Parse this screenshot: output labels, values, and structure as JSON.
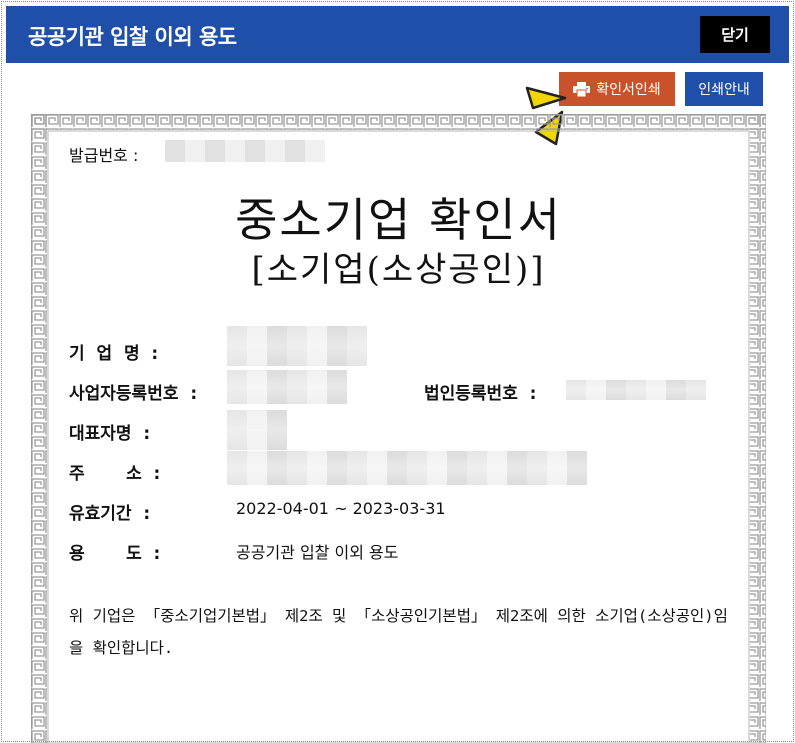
{
  "header": {
    "title": "공공기관 입찰 이외 용도",
    "close_label": "닫기"
  },
  "toolbar": {
    "print_label": "확인서인쇄",
    "guide_label": "인쇄안내"
  },
  "certificate": {
    "issue_label": "발급번호 :",
    "title": "중소기업 확인서",
    "subtitle": "[소기업(소상공인)]",
    "fields": {
      "company_label": "기  업  명  :",
      "business_reg_label": "사업자등록번호  :",
      "corp_reg_label": "법인등록번호  :",
      "ceo_label": "대표자명  :",
      "address_label": "주       소  :",
      "validity_label": "유효기간  :",
      "validity_value": "2022-04-01 ~ 2023-03-31",
      "purpose_label": "용       도  :",
      "purpose_value": "공공기관 입찰 이외 용도"
    },
    "statement": " 위 기업은 「중소기업기본법」 제2조 및 「소상공인기본법」 제2조에 의한 소기업(소상공인)임을 확인합니다."
  },
  "colors": {
    "header_bg": "#1f4fa8",
    "print_button_bg": "#c8522a",
    "guide_button_bg": "#1f4fa8",
    "close_button_bg": "#000000",
    "pointer_yellow": "#f2d600"
  },
  "icons": {
    "print": "printer-icon",
    "pointer": "yellow-pointer-icon"
  }
}
